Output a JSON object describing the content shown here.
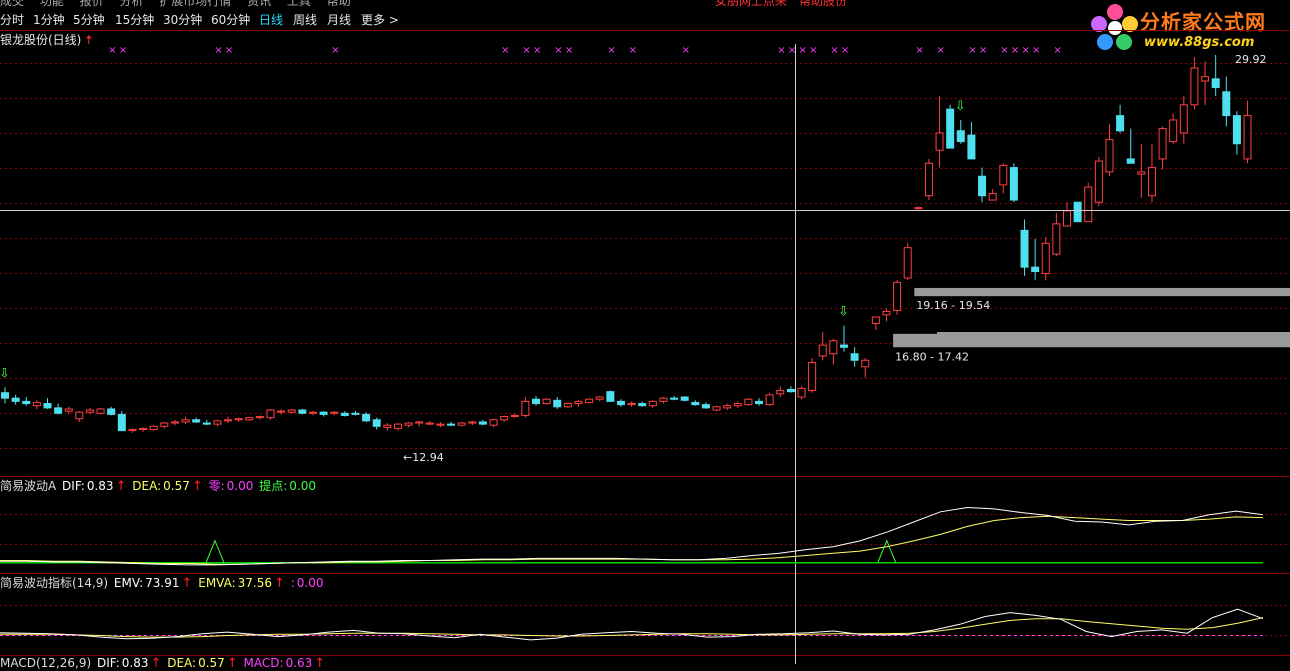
{
  "toolbar": {
    "timeframes": [
      "分时",
      "1分钟",
      "5分钟",
      "15分钟",
      "30分钟",
      "60分钟",
      "日线",
      "周线",
      "月线",
      "更多 >"
    ],
    "active": "日线",
    "top_fragment": "成交　 功能 　报价 　分析 　扩展市场行情 　资讯 　工具 　帮助",
    "red_fragment": "女朋网上点来　帮助股份"
  },
  "stock_title": "银龙股份(日线)",
  "logo": {
    "name": "分析家公式网",
    "url": "www.88gs.com"
  },
  "colors": {
    "up": "#ff4040",
    "down": "#4fe0ef",
    "grid": "#8b0000",
    "cross": "#cfcfcf",
    "dif": "#ffffff",
    "dea": "#ffff66",
    "zero": "#00d000",
    "mark": "#ff40ff",
    "signal": "#40ff40",
    "box": "#9a9a9a"
  },
  "chart_data": [
    {
      "type": "candlestick",
      "title": "银龙股份(日线)",
      "price_labels": {
        "high": "29.92",
        "low": "12.94"
      },
      "ylim": [
        11.5,
        30.3
      ],
      "candles": [
        [
          14.7,
          14.95,
          14.2,
          14.45
        ],
        [
          14.45,
          14.6,
          14.15,
          14.3
        ],
        [
          14.3,
          14.5,
          14.1,
          14.2
        ],
        [
          14.1,
          14.35,
          13.95,
          14.25
        ],
        [
          14.2,
          14.45,
          13.95,
          14.0
        ],
        [
          14.0,
          14.2,
          13.7,
          13.75
        ],
        [
          13.85,
          14.05,
          13.7,
          13.95
        ],
        [
          13.5,
          13.85,
          13.35,
          13.8
        ],
        [
          13.8,
          14.0,
          13.7,
          13.9
        ],
        [
          13.75,
          14.0,
          13.7,
          13.95
        ],
        [
          13.95,
          14.05,
          13.65,
          13.7
        ],
        [
          13.7,
          13.85,
          12.95,
          12.95
        ],
        [
          12.95,
          13.05,
          12.85,
          13.0
        ],
        [
          13.0,
          13.1,
          12.9,
          13.05
        ],
        [
          13.0,
          13.2,
          12.95,
          13.15
        ],
        [
          13.15,
          13.35,
          13.05,
          13.3
        ],
        [
          13.3,
          13.45,
          13.2,
          13.35
        ],
        [
          13.35,
          13.6,
          13.25,
          13.45
        ],
        [
          13.45,
          13.55,
          13.3,
          13.35
        ],
        [
          13.3,
          13.45,
          13.2,
          13.25
        ],
        [
          13.25,
          13.45,
          13.15,
          13.4
        ],
        [
          13.4,
          13.6,
          13.3,
          13.45
        ],
        [
          13.45,
          13.55,
          13.35,
          13.5
        ],
        [
          13.45,
          13.6,
          13.4,
          13.55
        ],
        [
          13.55,
          13.65,
          13.45,
          13.6
        ],
        [
          13.55,
          13.95,
          13.45,
          13.9
        ],
        [
          13.85,
          13.95,
          13.7,
          13.85
        ],
        [
          13.8,
          13.95,
          13.75,
          13.9
        ],
        [
          13.9,
          13.95,
          13.7,
          13.75
        ],
        [
          13.75,
          13.85,
          13.65,
          13.8
        ],
        [
          13.8,
          13.85,
          13.6,
          13.7
        ],
        [
          13.75,
          13.85,
          13.65,
          13.8
        ],
        [
          13.75,
          13.85,
          13.6,
          13.65
        ],
        [
          13.75,
          13.85,
          13.65,
          13.7
        ],
        [
          13.7,
          13.8,
          13.35,
          13.4
        ],
        [
          13.45,
          13.55,
          13.0,
          13.15
        ],
        [
          13.1,
          13.3,
          12.94,
          13.2
        ],
        [
          13.05,
          13.3,
          12.95,
          13.25
        ],
        [
          13.2,
          13.35,
          13.1,
          13.3
        ],
        [
          13.3,
          13.4,
          13.15,
          13.35
        ],
        [
          13.25,
          13.4,
          13.2,
          13.3
        ],
        [
          13.2,
          13.35,
          13.1,
          13.25
        ],
        [
          13.25,
          13.35,
          13.15,
          13.2
        ],
        [
          13.2,
          13.35,
          13.15,
          13.3
        ],
        [
          13.3,
          13.4,
          13.2,
          13.35
        ],
        [
          13.35,
          13.45,
          13.2,
          13.25
        ],
        [
          13.2,
          13.5,
          13.1,
          13.45
        ],
        [
          13.45,
          13.65,
          13.35,
          13.6
        ],
        [
          13.6,
          13.75,
          13.55,
          13.65
        ],
        [
          13.65,
          14.5,
          13.55,
          14.3
        ],
        [
          14.4,
          14.55,
          14.1,
          14.2
        ],
        [
          14.2,
          14.45,
          14.15,
          14.4
        ],
        [
          14.35,
          14.5,
          13.95,
          14.05
        ],
        [
          14.05,
          14.25,
          14.0,
          14.2
        ],
        [
          14.2,
          14.35,
          14.05,
          14.3
        ],
        [
          14.25,
          14.45,
          14.2,
          14.4
        ],
        [
          14.4,
          14.55,
          14.3,
          14.5
        ],
        [
          14.75,
          14.8,
          14.3,
          14.3
        ],
        [
          14.3,
          14.4,
          14.05,
          14.15
        ],
        [
          14.15,
          14.3,
          14.05,
          14.2
        ],
        [
          14.2,
          14.3,
          14.05,
          14.1
        ],
        [
          14.1,
          14.35,
          14.0,
          14.3
        ],
        [
          14.3,
          14.5,
          14.2,
          14.45
        ],
        [
          14.45,
          14.55,
          14.35,
          14.4
        ],
        [
          14.5,
          14.55,
          14.3,
          14.35
        ],
        [
          14.25,
          14.35,
          14.1,
          14.15
        ],
        [
          14.15,
          14.25,
          13.95,
          14.0
        ],
        [
          13.9,
          14.1,
          13.85,
          14.05
        ],
        [
          14.0,
          14.2,
          13.9,
          14.1
        ],
        [
          14.1,
          14.3,
          14.0,
          14.2
        ],
        [
          14.15,
          14.45,
          14.1,
          14.4
        ],
        [
          14.3,
          14.45,
          14.1,
          14.2
        ],
        [
          14.15,
          14.7,
          14.1,
          14.6
        ],
        [
          14.65,
          15.0,
          14.5,
          14.8
        ],
        [
          14.85,
          15.0,
          14.7,
          14.75
        ],
        [
          14.5,
          15.0,
          14.4,
          14.9
        ],
        [
          14.8,
          16.3,
          14.7,
          16.1
        ],
        [
          16.4,
          17.5,
          16.2,
          16.9
        ],
        [
          16.5,
          17.2,
          16.0,
          17.1
        ],
        [
          16.9,
          17.8,
          16.6,
          16.8
        ],
        [
          16.5,
          16.8,
          15.9,
          16.2
        ],
        [
          15.9,
          16.3,
          15.4,
          16.2
        ],
        [
          17.9,
          18.2,
          17.6,
          18.2
        ],
        [
          18.3,
          18.6,
          18.0,
          18.45
        ],
        [
          18.5,
          19.9,
          18.3,
          19.8
        ],
        [
          20.0,
          21.6,
          19.9,
          21.4
        ],
        [
          23.2,
          23.3,
          23.15,
          23.25
        ],
        [
          23.8,
          25.5,
          23.6,
          25.3
        ],
        [
          25.9,
          28.4,
          25.1,
          26.7
        ],
        [
          27.8,
          28.0,
          27.1,
          26.0
        ],
        [
          26.8,
          27.3,
          26.2,
          26.3
        ],
        [
          26.6,
          27.2,
          25.5,
          25.5
        ],
        [
          24.7,
          25.1,
          23.5,
          23.8
        ],
        [
          23.6,
          24.1,
          23.7,
          23.9
        ],
        [
          24.3,
          25.3,
          23.9,
          25.2
        ],
        [
          25.1,
          25.3,
          23.5,
          23.6
        ],
        [
          22.2,
          22.7,
          20.1,
          20.5
        ],
        [
          20.5,
          21.8,
          19.9,
          20.3
        ],
        [
          20.2,
          21.9,
          19.9,
          21.6
        ],
        [
          21.1,
          23.0,
          21.0,
          22.5
        ],
        [
          22.4,
          23.5,
          22.4,
          23.1
        ],
        [
          23.5,
          22.9,
          22.8,
          22.6
        ],
        [
          22.6,
          24.4,
          22.6,
          24.2
        ],
        [
          23.5,
          25.6,
          23.3,
          25.4
        ],
        [
          24.9,
          27.1,
          24.7,
          26.4
        ],
        [
          27.5,
          28.0,
          26.7,
          26.8
        ],
        [
          25.5,
          26.9,
          25.3,
          25.3
        ],
        [
          24.8,
          26.2,
          23.7,
          24.9
        ],
        [
          23.8,
          26.2,
          23.5,
          25.1
        ],
        [
          25.5,
          27.0,
          25.0,
          26.9
        ],
        [
          26.3,
          27.6,
          26.2,
          27.3
        ],
        [
          26.7,
          28.4,
          26.2,
          28.0
        ],
        [
          28.0,
          30.2,
          27.8,
          29.7
        ],
        [
          29.1,
          30.0,
          28.0,
          29.3
        ],
        [
          29.2,
          30.3,
          28.4,
          28.8
        ],
        [
          28.6,
          29.3,
          27.0,
          27.5
        ],
        [
          27.5,
          27.7,
          25.7,
          26.2
        ],
        [
          25.5,
          28.2,
          25.3,
          27.5
        ]
      ],
      "cross_marks": [
        10,
        11,
        20,
        21,
        31,
        47,
        49,
        50,
        52,
        53,
        57,
        59,
        64,
        73,
        74,
        75,
        76,
        78,
        79,
        86,
        88,
        91,
        92,
        94,
        95,
        96,
        97,
        99
      ],
      "down_arrow_markers": [
        0,
        79,
        90
      ],
      "boxes": [
        {
          "low": 19.16,
          "high": 19.54,
          "label": "19.16 - 19.54",
          "start": 86
        },
        {
          "low": 16.8,
          "high": 17.42,
          "label": "16.80 - 17.42",
          "start": 84
        }
      ]
    },
    {
      "type": "line",
      "title": "简易波动A",
      "values": {
        "DIF": "0.83",
        "DEA": "0.57",
        "零": "0.00",
        "提点": "0.00"
      },
      "ylim": [
        -0.1,
        1.0
      ],
      "series": [
        {
          "name": "DIF",
          "values": [
            0.02,
            0.02,
            0.01,
            0.01,
            0.0,
            -0.01,
            -0.02,
            -0.03,
            -0.03,
            -0.02,
            -0.01,
            0.0,
            0.01,
            0.02,
            0.02,
            0.03,
            0.03,
            0.04,
            0.05,
            0.05,
            0.06,
            0.06,
            0.06,
            0.06,
            0.05,
            0.04,
            0.04,
            0.06,
            0.1,
            0.13,
            0.18,
            0.22,
            0.3,
            0.42,
            0.56,
            0.7,
            0.76,
            0.74,
            0.69,
            0.65,
            0.57,
            0.56,
            0.52,
            0.57,
            0.58,
            0.66,
            0.71,
            0.66
          ]
        },
        {
          "name": "DEA",
          "values": [
            0.03,
            0.03,
            0.02,
            0.02,
            0.01,
            0.0,
            -0.01,
            -0.01,
            -0.02,
            -0.02,
            -0.01,
            0.0,
            0.0,
            0.01,
            0.01,
            0.02,
            0.03,
            0.03,
            0.04,
            0.04,
            0.05,
            0.05,
            0.05,
            0.05,
            0.05,
            0.04,
            0.04,
            0.04,
            0.05,
            0.07,
            0.1,
            0.13,
            0.16,
            0.22,
            0.3,
            0.39,
            0.5,
            0.58,
            0.62,
            0.64,
            0.62,
            0.6,
            0.58,
            0.58,
            0.58,
            0.6,
            0.63,
            0.62
          ]
        },
        {
          "name": "零",
          "values": [
            0,
            0,
            0,
            0,
            0,
            0,
            0,
            0,
            0,
            0,
            0,
            0,
            0,
            0,
            0,
            0,
            0,
            0,
            0,
            0,
            0,
            0,
            0,
            0,
            0,
            0,
            0,
            0,
            0,
            0,
            0,
            0,
            0,
            0,
            0,
            0,
            0,
            0,
            0,
            0,
            0,
            0,
            0,
            0,
            0,
            0,
            0,
            0
          ]
        }
      ],
      "signals": [
        8,
        33
      ]
    },
    {
      "type": "line",
      "title": "简易波动指标(14,9)",
      "values": {
        "EMV": "73.91",
        "EMVA": "37.56",
        "": "0.00"
      },
      "ylim": [
        -35,
        85
      ],
      "series": [
        {
          "name": "EMV",
          "values": [
            5,
            4,
            3,
            1,
            -3,
            -6,
            -5,
            -2,
            3,
            6,
            2,
            -2,
            1,
            6,
            9,
            4,
            3,
            -1,
            -4,
            2,
            -3,
            -8,
            -5,
            2,
            5,
            7,
            4,
            2,
            -3,
            -2,
            2,
            3,
            5,
            8,
            2,
            1,
            2,
            10,
            20,
            34,
            41,
            36,
            29,
            7,
            -2,
            7,
            10,
            4,
            32,
            47,
            30
          ]
        },
        {
          "name": "EMVA",
          "values": [
            2,
            2,
            2,
            1,
            0,
            -2,
            -3,
            -3,
            -2,
            0,
            1,
            2,
            2,
            3,
            4,
            4,
            4,
            3,
            2,
            1,
            1,
            0,
            -1,
            -1,
            0,
            1,
            2,
            3,
            3,
            2,
            1,
            1,
            2,
            3,
            3,
            3,
            4,
            7,
            13,
            20,
            27,
            30,
            30,
            25,
            21,
            17,
            13,
            11,
            14,
            22,
            32
          ]
        },
        {
          "name": "",
          "values": [
            0,
            0,
            0,
            0,
            0,
            0,
            0,
            0,
            0,
            0,
            0,
            0,
            0,
            0,
            0,
            0,
            0,
            0,
            0,
            0,
            0,
            0,
            0,
            0,
            0,
            0,
            0,
            0,
            0,
            0,
            0,
            0,
            0,
            0,
            0,
            0,
            0,
            0,
            0,
            0,
            0,
            0,
            0,
            0,
            0,
            0,
            0,
            0,
            0,
            0,
            0
          ]
        }
      ]
    }
  ],
  "macd_label": {
    "title": "MACD(12,26,9)",
    "DIF": "0.83",
    "DEA": "0.57",
    "MACD": "0.63"
  }
}
